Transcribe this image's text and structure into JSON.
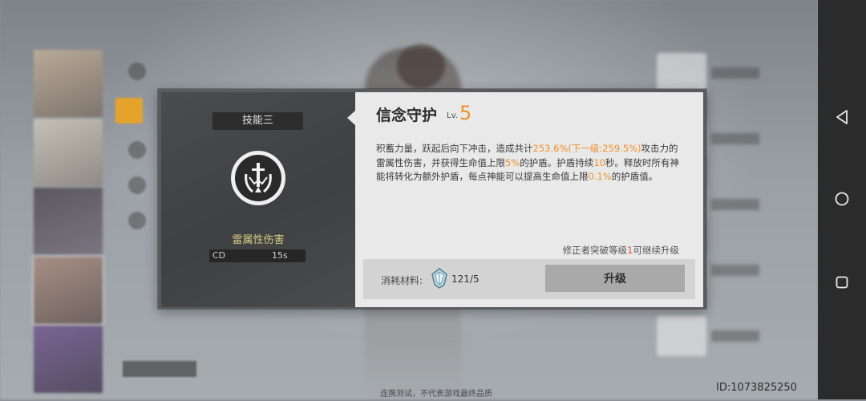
{
  "skill_panel": {
    "tag": "技能三",
    "damage_type": "雷属性伤害",
    "cd_label": "CD",
    "cd_value": "15s"
  },
  "skill_detail": {
    "name": "信念守护",
    "lv_label": "Lv.",
    "lv_value": "5",
    "desc": [
      {
        "t": "积蓄力量，跃起后向下冲击，造成共计",
        "hl": false
      },
      {
        "t": "253.6%(下一级:259.5%)",
        "hl": true
      },
      {
        "t": "攻击力的雷属性伤害，并获得生命值上限",
        "hl": false
      },
      {
        "t": "5%",
        "hl": true
      },
      {
        "t": "的护盾。护盾持续",
        "hl": false
      },
      {
        "t": "10",
        "hl": true
      },
      {
        "t": "秒。释放时所有神能将转化为额外护盾，每点神能可以提高生命值上限",
        "hl": false
      },
      {
        "t": "0.1%",
        "hl": true
      },
      {
        "t": "的护盾值。",
        "hl": false
      }
    ],
    "upgrade_note_prefix": "修正者突破等级",
    "upgrade_note_level": "1",
    "upgrade_note_suffix": "可继续升级",
    "material_label": "消耗材料:",
    "material_icon": "crystal-icon",
    "material_count": "121/5",
    "upgrade_button": "升级"
  },
  "footer": {
    "note": "连携测试，不代表游戏最终品质",
    "id": "ID:1073825250"
  },
  "navbar": {
    "icons": [
      "back-triangle-icon",
      "home-circle-icon",
      "recents-square-icon"
    ]
  },
  "colors": {
    "highlight": "#f0902a",
    "damage_type": "#d9cf84",
    "accent_menu": "#e5a32b"
  }
}
